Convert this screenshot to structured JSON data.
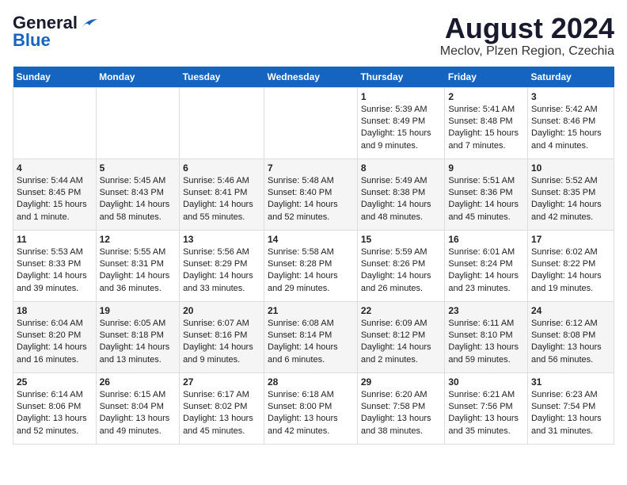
{
  "logo": {
    "general": "General",
    "blue": "Blue"
  },
  "title": "August 2024",
  "subtitle": "Meclov, Plzen Region, Czechia",
  "weekdays": [
    "Sunday",
    "Monday",
    "Tuesday",
    "Wednesday",
    "Thursday",
    "Friday",
    "Saturday"
  ],
  "weeks": [
    [
      {
        "day": "",
        "content": ""
      },
      {
        "day": "",
        "content": ""
      },
      {
        "day": "",
        "content": ""
      },
      {
        "day": "",
        "content": ""
      },
      {
        "day": "1",
        "content": "Sunrise: 5:39 AM\nSunset: 8:49 PM\nDaylight: 15 hours and 9 minutes."
      },
      {
        "day": "2",
        "content": "Sunrise: 5:41 AM\nSunset: 8:48 PM\nDaylight: 15 hours and 7 minutes."
      },
      {
        "day": "3",
        "content": "Sunrise: 5:42 AM\nSunset: 8:46 PM\nDaylight: 15 hours and 4 minutes."
      }
    ],
    [
      {
        "day": "4",
        "content": "Sunrise: 5:44 AM\nSunset: 8:45 PM\nDaylight: 15 hours and 1 minute."
      },
      {
        "day": "5",
        "content": "Sunrise: 5:45 AM\nSunset: 8:43 PM\nDaylight: 14 hours and 58 minutes."
      },
      {
        "day": "6",
        "content": "Sunrise: 5:46 AM\nSunset: 8:41 PM\nDaylight: 14 hours and 55 minutes."
      },
      {
        "day": "7",
        "content": "Sunrise: 5:48 AM\nSunset: 8:40 PM\nDaylight: 14 hours and 52 minutes."
      },
      {
        "day": "8",
        "content": "Sunrise: 5:49 AM\nSunset: 8:38 PM\nDaylight: 14 hours and 48 minutes."
      },
      {
        "day": "9",
        "content": "Sunrise: 5:51 AM\nSunset: 8:36 PM\nDaylight: 14 hours and 45 minutes."
      },
      {
        "day": "10",
        "content": "Sunrise: 5:52 AM\nSunset: 8:35 PM\nDaylight: 14 hours and 42 minutes."
      }
    ],
    [
      {
        "day": "11",
        "content": "Sunrise: 5:53 AM\nSunset: 8:33 PM\nDaylight: 14 hours and 39 minutes."
      },
      {
        "day": "12",
        "content": "Sunrise: 5:55 AM\nSunset: 8:31 PM\nDaylight: 14 hours and 36 minutes."
      },
      {
        "day": "13",
        "content": "Sunrise: 5:56 AM\nSunset: 8:29 PM\nDaylight: 14 hours and 33 minutes."
      },
      {
        "day": "14",
        "content": "Sunrise: 5:58 AM\nSunset: 8:28 PM\nDaylight: 14 hours and 29 minutes."
      },
      {
        "day": "15",
        "content": "Sunrise: 5:59 AM\nSunset: 8:26 PM\nDaylight: 14 hours and 26 minutes."
      },
      {
        "day": "16",
        "content": "Sunrise: 6:01 AM\nSunset: 8:24 PM\nDaylight: 14 hours and 23 minutes."
      },
      {
        "day": "17",
        "content": "Sunrise: 6:02 AM\nSunset: 8:22 PM\nDaylight: 14 hours and 19 minutes."
      }
    ],
    [
      {
        "day": "18",
        "content": "Sunrise: 6:04 AM\nSunset: 8:20 PM\nDaylight: 14 hours and 16 minutes."
      },
      {
        "day": "19",
        "content": "Sunrise: 6:05 AM\nSunset: 8:18 PM\nDaylight: 14 hours and 13 minutes."
      },
      {
        "day": "20",
        "content": "Sunrise: 6:07 AM\nSunset: 8:16 PM\nDaylight: 14 hours and 9 minutes."
      },
      {
        "day": "21",
        "content": "Sunrise: 6:08 AM\nSunset: 8:14 PM\nDaylight: 14 hours and 6 minutes."
      },
      {
        "day": "22",
        "content": "Sunrise: 6:09 AM\nSunset: 8:12 PM\nDaylight: 14 hours and 2 minutes."
      },
      {
        "day": "23",
        "content": "Sunrise: 6:11 AM\nSunset: 8:10 PM\nDaylight: 13 hours and 59 minutes."
      },
      {
        "day": "24",
        "content": "Sunrise: 6:12 AM\nSunset: 8:08 PM\nDaylight: 13 hours and 56 minutes."
      }
    ],
    [
      {
        "day": "25",
        "content": "Sunrise: 6:14 AM\nSunset: 8:06 PM\nDaylight: 13 hours and 52 minutes."
      },
      {
        "day": "26",
        "content": "Sunrise: 6:15 AM\nSunset: 8:04 PM\nDaylight: 13 hours and 49 minutes."
      },
      {
        "day": "27",
        "content": "Sunrise: 6:17 AM\nSunset: 8:02 PM\nDaylight: 13 hours and 45 minutes."
      },
      {
        "day": "28",
        "content": "Sunrise: 6:18 AM\nSunset: 8:00 PM\nDaylight: 13 hours and 42 minutes."
      },
      {
        "day": "29",
        "content": "Sunrise: 6:20 AM\nSunset: 7:58 PM\nDaylight: 13 hours and 38 minutes."
      },
      {
        "day": "30",
        "content": "Sunrise: 6:21 AM\nSunset: 7:56 PM\nDaylight: 13 hours and 35 minutes."
      },
      {
        "day": "31",
        "content": "Sunrise: 6:23 AM\nSunset: 7:54 PM\nDaylight: 13 hours and 31 minutes."
      }
    ]
  ]
}
